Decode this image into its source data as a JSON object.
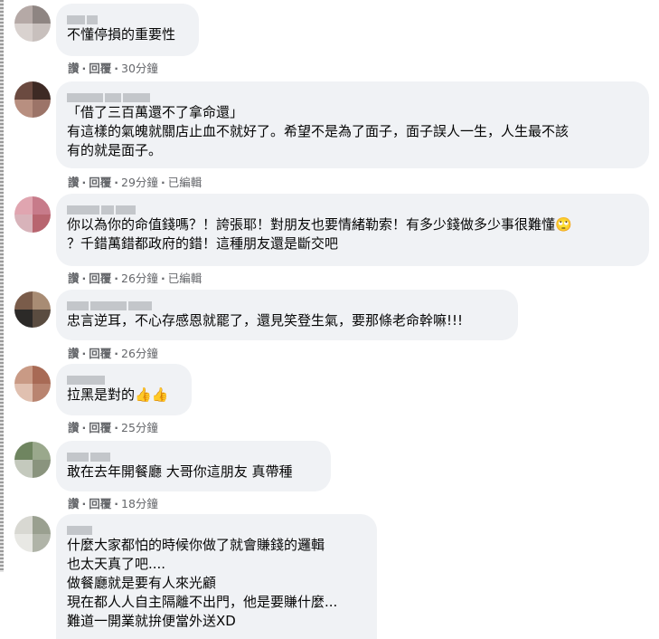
{
  "comments": [
    {
      "text": "不懂停損的重要性",
      "like": "讚",
      "reply": "回覆",
      "time": "30分鐘",
      "edited": ""
    },
    {
      "text": "「借了三百萬還不了拿命還」\n有這樣的氣魄就關店止血不就好了。希望不是為了面子，面子誤人一生，人生最不該\n有的就是面子。",
      "like": "讚",
      "reply": "回覆",
      "time": "29分鐘",
      "edited": "已編輯"
    },
    {
      "text": "你以為你的命值錢嗎？！誇張耶！對朋友也要情緒勒索！有多少錢做多少事很難懂",
      "text2": "？千錯萬錯都政府的錯！這種朋友還是斷交吧",
      "emoji": "🙄",
      "like": "讚",
      "reply": "回覆",
      "time": "26分鐘",
      "edited": "已編輯"
    },
    {
      "text": "忠言逆耳，不心存感恩就罷了，還見笑登生氣，要那條老命幹嘛!!!",
      "like": "讚",
      "reply": "回覆",
      "time": "26分鐘",
      "edited": ""
    },
    {
      "text": "拉黑是對的",
      "emoji": "👍👍",
      "like": "讚",
      "reply": "回覆",
      "time": "25分鐘",
      "edited": ""
    },
    {
      "text": "敢在去年開餐廳 大哥你這朋友 真帶種",
      "like": "讚",
      "reply": "回覆",
      "time": "18分鐘",
      "edited": ""
    },
    {
      "text": "什麼大家都怕的時候你做了就會賺錢的邏輯\n也太天真了吧....\n做餐廳就是要有人來光顧\n現在都人人自主隔離不出門，他是要賺什麼...\n難道一開業就拚便當外送XD",
      "like": "",
      "reply": "",
      "time": "",
      "edited": ""
    }
  ],
  "colors": {
    "bubble_bg": "#f0f2f5",
    "meta_text": "#65676b",
    "text": "#050505"
  },
  "icons": [
    "blurred-avatar",
    "thumbs-up-emoji",
    "eye-roll-emoji"
  ]
}
